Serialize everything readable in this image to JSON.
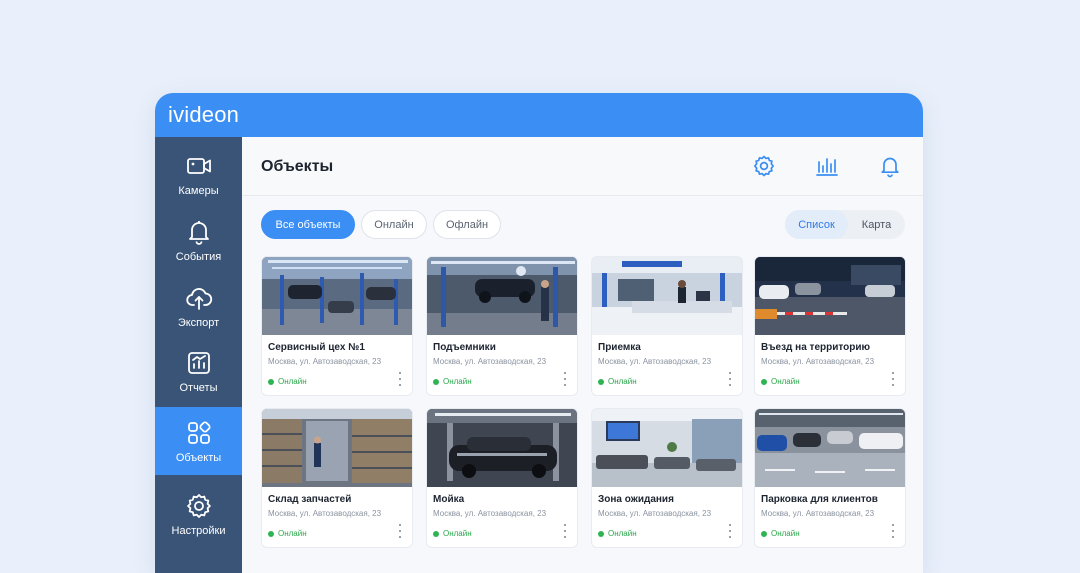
{
  "app": {
    "logo": "ivideon"
  },
  "sidebar": {
    "items": [
      {
        "label": "Камеры",
        "icon": "camera-icon"
      },
      {
        "label": "События",
        "icon": "bell-icon"
      },
      {
        "label": "Экспорт",
        "icon": "cloud-upload-icon"
      },
      {
        "label": "Отчеты",
        "icon": "reports-icon"
      },
      {
        "label": "Объекты",
        "icon": "objects-icon",
        "active": true
      },
      {
        "label": "Настройки",
        "icon": "settings-icon"
      }
    ]
  },
  "main": {
    "title": "Объекты",
    "header_icons": [
      "settings-gear-icon",
      "analytics-bars-icon",
      "notification-bell-icon"
    ],
    "filters": [
      {
        "label": "Все объекты",
        "active": true
      },
      {
        "label": "Онлайн",
        "active": false
      },
      {
        "label": "Офлайн",
        "active": false
      }
    ],
    "view_toggle": [
      {
        "label": "Список",
        "active": true
      },
      {
        "label": "Карта",
        "active": false
      }
    ],
    "cards": [
      {
        "title": "Сервисный цех №1",
        "address": "Москва, ул. Автозаводская, 23",
        "status": "Онлайн"
      },
      {
        "title": "Подъемники",
        "address": "Москва, ул. Автозаводская, 23",
        "status": "Онлайн"
      },
      {
        "title": "Приемка",
        "address": "Москва, ул. Автозаводская, 23",
        "status": "Онлайн"
      },
      {
        "title": "Въезд на территорию",
        "address": "Москва, ул. Автозаводская, 23",
        "status": "Онлайн"
      },
      {
        "title": "Склад запчастей",
        "address": "Москва, ул. Автозаводская, 23",
        "status": "Онлайн"
      },
      {
        "title": "Мойка",
        "address": "Москва, ул. Автозаводская, 23",
        "status": "Онлайн"
      },
      {
        "title": "Зона ожидания",
        "address": "Москва, ул. Автозаводская, 23",
        "status": "Онлайн"
      },
      {
        "title": "Парковка для клиентов",
        "address": "Москва, ул. Автозаводская, 23",
        "status": "Онлайн"
      }
    ]
  },
  "colors": {
    "accent": "#3b8ef3",
    "sidebar": "#3a5477",
    "online": "#2fb453",
    "background": "#e9f0fb"
  }
}
